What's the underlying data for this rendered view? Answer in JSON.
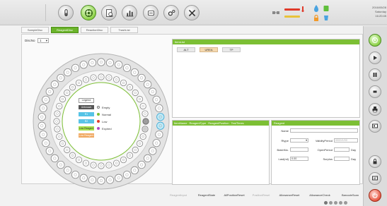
{
  "topbar": {
    "buttons": [
      "tube-icon",
      "reagent-icon",
      "report-icon",
      "chart-icon",
      "bottle-icon",
      "settings-icon",
      "tools-icon"
    ],
    "datetime": {
      "date": "2016/05/28",
      "day": "Saturday",
      "time": "16:20:45"
    }
  },
  "tabs": [
    {
      "label": "SampleDisc"
    },
    {
      "label": "ReagentDisc"
    },
    {
      "label": "ReactionDisc"
    },
    {
      "label": "TrashList"
    }
  ],
  "disc": {
    "label": "DiscNo",
    "value": "1",
    "legend": {
      "header": "Legend",
      "items": [
        {
          "label": "Unknown",
          "desc": "Empty",
          "color": "#ffffff"
        },
        {
          "label": "R1",
          "desc": "Normal",
          "color": "#55c3e6"
        },
        {
          "label": "R2",
          "desc": "Low",
          "color": "#5ac3e6"
        },
        {
          "label": "Low Reagent",
          "desc": "Expired",
          "color": "#a8e04a"
        },
        {
          "label": "Low Reagent",
          "desc": "",
          "color": "#f0a860"
        }
      ]
    }
  },
  "item_list": {
    "title": "ItemList",
    "items": [
      "ALT",
      "UREA",
      "TP"
    ]
  },
  "table": {
    "columns": [
      "ItemName",
      "ReagentType",
      "ReagentPosition",
      "TestTimes"
    ]
  },
  "reagent": {
    "title": "Reagent",
    "fields": {
      "name": {
        "label": "Name",
        "value": ""
      },
      "rtype": {
        "label": "Rtype",
        "value": ""
      },
      "validity": {
        "label": "ValidityPeriod",
        "value": "0000/1/00"
      },
      "batch": {
        "label": "BatchNo.",
        "value": ""
      },
      "open": {
        "label": "OpenPeriod",
        "value": "",
        "unit": "Day"
      },
      "last": {
        "label": "Last(ml)",
        "value": "0.00"
      },
      "surplus": {
        "label": "Surplus",
        "value": "",
        "unit": "Day"
      }
    }
  },
  "bottom_buttons": [
    {
      "label": "ReagentInput",
      "disabled": true
    },
    {
      "label": "ReagentState",
      "disabled": false
    },
    {
      "label": "AllPositionReset",
      "disabled": false
    },
    {
      "label": "PositionReset",
      "disabled": true
    },
    {
      "label": "AllowanceReset",
      "disabled": false
    },
    {
      "label": "AllowanceCheck",
      "disabled": false
    },
    {
      "label": "BarcodeScan",
      "disabled": false
    }
  ],
  "colors": {
    "accent": "#7cbf34",
    "active_tab": "#6bb42a",
    "alarm": "#e03a2a"
  }
}
